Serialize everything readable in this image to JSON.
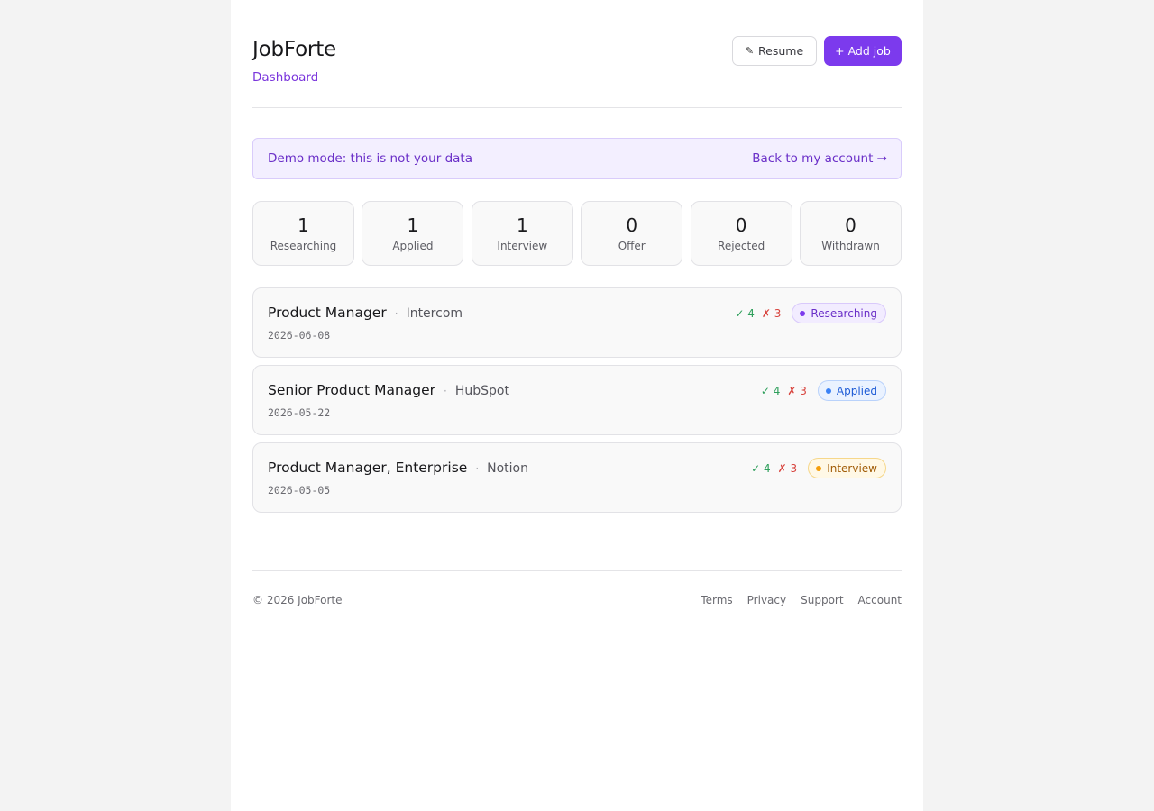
{
  "header": {
    "title": "JobForte",
    "subnav": "Dashboard",
    "resume_icon": "pencil-icon",
    "resume_label": "Resume",
    "add_job_label": "+ Add job"
  },
  "banner": {
    "text": "Demo mode: this is not your data",
    "link": "Back to my account →"
  },
  "stats": [
    {
      "count": "1",
      "label": "Researching"
    },
    {
      "count": "1",
      "label": "Applied"
    },
    {
      "count": "1",
      "label": "Interview"
    },
    {
      "count": "0",
      "label": "Offer"
    },
    {
      "count": "0",
      "label": "Rejected"
    },
    {
      "count": "0",
      "label": "Withdrawn"
    }
  ],
  "jobs": [
    {
      "title": "Product Manager",
      "company": "Intercom",
      "date": "2026-06-08",
      "pros": "✓ 4",
      "cons": "✗ 3",
      "status": "Researching",
      "status_color": "#7c3aed"
    },
    {
      "title": "Senior Product Manager",
      "company": "HubSpot",
      "date": "2026-05-22",
      "pros": "✓ 4",
      "cons": "✗ 3",
      "status": "Applied",
      "status_color": "#3b82f6"
    },
    {
      "title": "Product Manager, Enterprise",
      "company": "Notion",
      "date": "2026-05-05",
      "pros": "✓ 4",
      "cons": "✗ 3",
      "status": "Interview",
      "status_color": "#f59e0b"
    }
  ],
  "job_separator": "·",
  "footer": {
    "copyright": "© 2026 JobForte",
    "links": [
      "Terms",
      "Privacy",
      "Support",
      "Account"
    ]
  },
  "colors": {
    "accent": "#7c3aed",
    "page_background": "#f3f3f3"
  }
}
